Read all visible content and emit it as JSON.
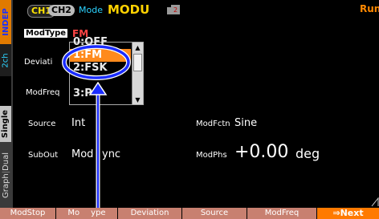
{
  "side_tabs": {
    "indep": "INDEP",
    "twoch": "2ch",
    "single": "Single",
    "dual": "Dual",
    "graph": "Graph"
  },
  "header": {
    "ch1": "CH1",
    "ch2": "CH2",
    "mode_label": "Mode",
    "mode_value": "MODU",
    "memo_number": "2",
    "run_status": "Run"
  },
  "fields": {
    "modtype_label": "ModType",
    "modtype_value": "FM",
    "deviation_label": "Deviati",
    "modfreq_label": "ModFreq",
    "source_label": "Source",
    "source_value": "Int",
    "modfctn_label": "ModFctn",
    "modfctn_value": "Sine",
    "subout_label": "SubOut",
    "subout_value_a": "Mod",
    "subout_value_b": "ync",
    "modphs_label": "ModPhs",
    "modphs_value": "+0.00",
    "modphs_unit": "deg"
  },
  "dropdown": {
    "options": [
      "0:OFF",
      "1:FM",
      "2:FSK",
      "3:P"
    ],
    "selected_index": 1
  },
  "bottom_bar": {
    "b1": "ModStop",
    "b2a": "Mo",
    "b2b": "ype",
    "b3": "Deviation",
    "b4": "Source",
    "b5": "ModFreq",
    "next": "⇒Next"
  },
  "colors": {
    "accent": "#ff8a1c",
    "highlight_ring": "#1a2cff",
    "label_cyan": "#2cd3ff",
    "value_yellow": "#ffd200"
  }
}
